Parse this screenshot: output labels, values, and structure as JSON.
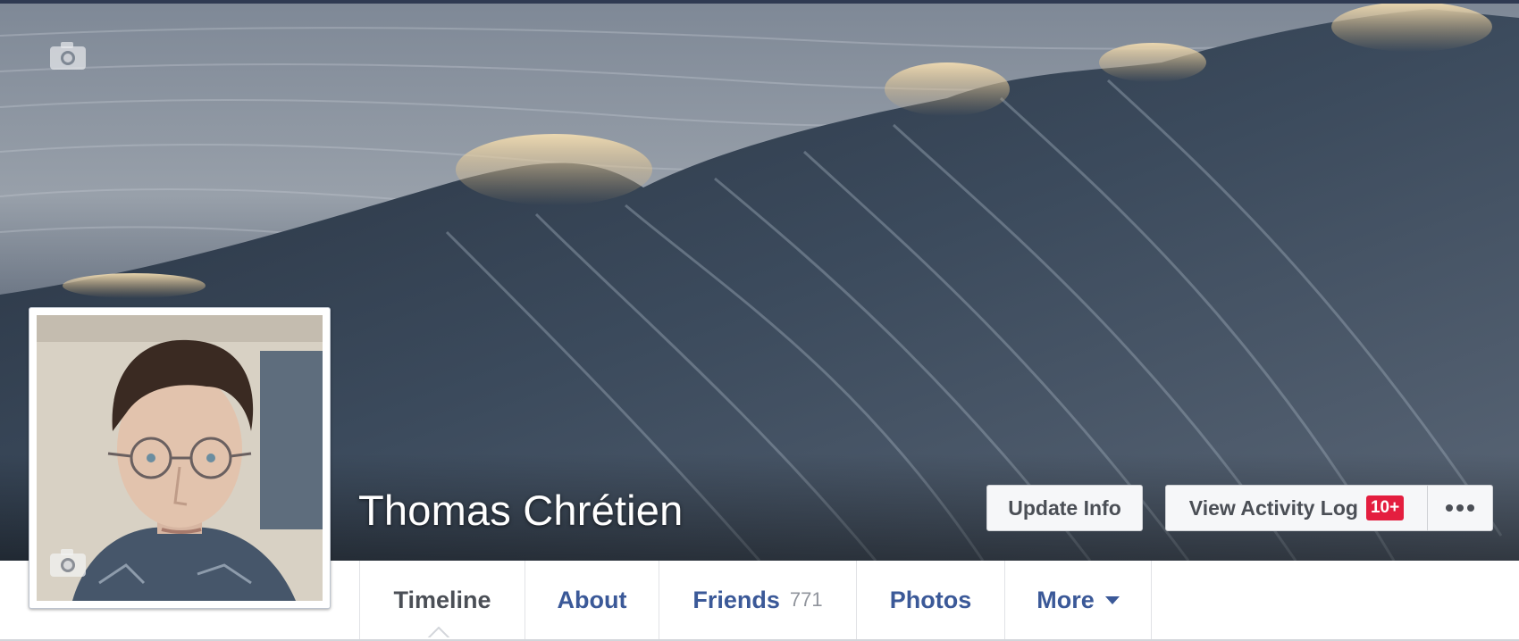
{
  "profile": {
    "name": "Thomas Chrétien"
  },
  "actions": {
    "update_info_label": "Update Info",
    "activity_log_label": "View Activity Log",
    "activity_badge": "10+"
  },
  "nav": {
    "tabs": [
      {
        "label": "Timeline",
        "active": true
      },
      {
        "label": "About"
      },
      {
        "label": "Friends",
        "count": "771"
      },
      {
        "label": "Photos"
      },
      {
        "label": "More"
      }
    ]
  },
  "icons": {
    "cover_camera": "camera-icon",
    "profile_camera": "camera-icon",
    "more_options": "ellipsis-icon",
    "more_dropdown": "caret-down-icon"
  },
  "colors": {
    "link_blue": "#3b5998",
    "badge_red": "#e41e3f",
    "button_bg": "#f6f7f9",
    "text_dark": "#4b4f56"
  }
}
